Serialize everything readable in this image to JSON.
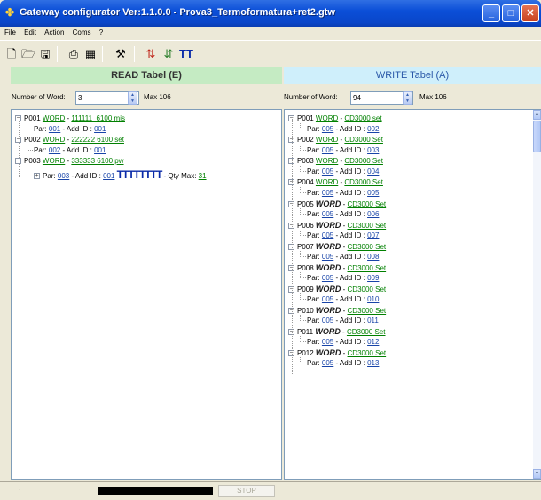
{
  "window": {
    "title": "Gateway configurator Ver:1.1.0.0 - Prova3_Termoformatura+ret2.gtw",
    "min_glyph": "_",
    "max_glyph": "□",
    "close_glyph": "✕"
  },
  "menu": [
    "File",
    "Edit",
    "Action",
    "Coms",
    "?"
  ],
  "toolbar": {
    "icons": [
      "new-file-icon",
      "open-folder-icon",
      "save-disk-icon",
      "print-icon",
      "calculator-icon",
      "tools-icon",
      "up-down-arrows-icon",
      "comb-icon"
    ]
  },
  "read": {
    "header": "READ Tabel (E)",
    "word_label": "Number of Word:",
    "word_value": "3",
    "max_label": "Max 106",
    "nodes": [
      {
        "id": "P001",
        "word": "WORD",
        "sep": " - ",
        "desc": "111111_6100 mis",
        "par_label": "Par:",
        "par": "001",
        "mid": " - Add ID : ",
        "addid": "001"
      },
      {
        "id": "P002",
        "word": "WORD",
        "sep": " - ",
        "desc": "222222 6100 set",
        "par_label": "Par:",
        "par": "002",
        "mid": " - Add ID : ",
        "addid": "001"
      },
      {
        "id": "P003",
        "word": "WORD",
        "sep": " - ",
        "desc": "333333 6100 pw",
        "par_label": "Par:",
        "par": "003",
        "mid": " - Add ID : ",
        "addid": "001",
        "qty_label": " - Qty Max:",
        "qty": "31"
      }
    ]
  },
  "write": {
    "header": "WRITE Tabel (A)",
    "word_label": "Number of Word:",
    "word_value": "94",
    "max_label": "Max 106",
    "nodes": [
      {
        "id": "P001",
        "word": "WORD",
        "sep": " - ",
        "desc": "CD3000 set",
        "par_label": "Par:",
        "par": "005",
        "mid": " - Add ID : ",
        "addid": "002"
      },
      {
        "id": "P002",
        "word": "WORD",
        "sep": " - ",
        "desc": "CD3000 Set",
        "par_label": "Par:",
        "par": "005",
        "mid": " - Add ID : ",
        "addid": "003"
      },
      {
        "id": "P003",
        "word": "WORD",
        "sep": " - ",
        "desc": "CD3000 Set",
        "par_label": "Par:",
        "par": "005",
        "mid": " - Add ID : ",
        "addid": "004"
      },
      {
        "id": "P004",
        "word": "WORD",
        "sep": " - ",
        "desc": "CD3000 Set",
        "par_label": "Par:",
        "par": "005",
        "mid": " - Add ID : ",
        "addid": "005"
      },
      {
        "id": "P005",
        "word": "WORD",
        "sep": " - ",
        "desc": "CD3000 Set",
        "par_label": "Par:",
        "par": "005",
        "mid": " - Add ID : ",
        "addid": "006"
      },
      {
        "id": "P006",
        "word": "WORD",
        "sep": " - ",
        "desc": "CD3000 Set",
        "par_label": "Par:",
        "par": "005",
        "mid": " - Add ID : ",
        "addid": "007"
      },
      {
        "id": "P007",
        "word": "WORD",
        "sep": " - ",
        "desc": "CD3000 Set",
        "par_label": "Par:",
        "par": "005",
        "mid": " - Add ID : ",
        "addid": "008"
      },
      {
        "id": "P008",
        "word": "WORD",
        "sep": " - ",
        "desc": "CD3000 Set",
        "par_label": "Par:",
        "par": "005",
        "mid": " - Add ID : ",
        "addid": "009"
      },
      {
        "id": "P009",
        "word": "WORD",
        "sep": " - ",
        "desc": "CD3000 Set",
        "par_label": "Par:",
        "par": "005",
        "mid": " - Add ID : ",
        "addid": "010"
      },
      {
        "id": "P010",
        "word": "WORD",
        "sep": " - ",
        "desc": "CD3000 Set",
        "par_label": "Par:",
        "par": "005",
        "mid": " - Add ID : ",
        "addid": "011"
      },
      {
        "id": "P011",
        "word": "WORD",
        "sep": " - ",
        "desc": "CD3000 Set",
        "par_label": "Par:",
        "par": "005",
        "mid": " - Add ID : ",
        "addid": "012"
      },
      {
        "id": "P012",
        "word": "WORD",
        "sep": " - ",
        "desc": "CD3000 Set",
        "par_label": "Par:",
        "par": "005",
        "mid": " - Add ID : ",
        "addid": "013"
      }
    ]
  },
  "status": {
    "dot": "·",
    "stop_label": "STOP"
  }
}
